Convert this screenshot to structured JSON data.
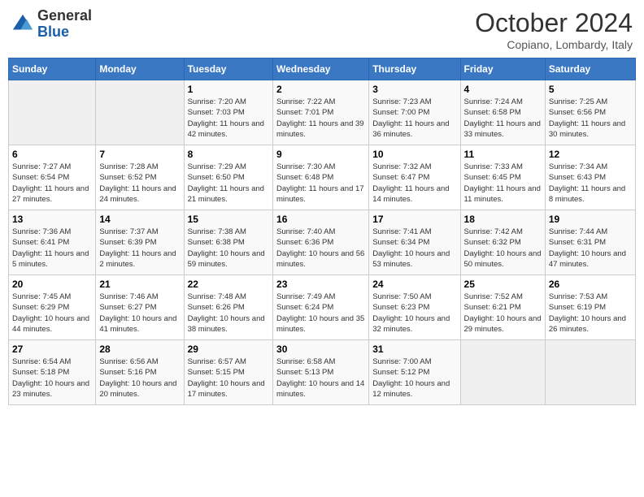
{
  "logo": {
    "general": "General",
    "blue": "Blue"
  },
  "header": {
    "month": "October 2024",
    "location": "Copiano, Lombardy, Italy"
  },
  "weekdays": [
    "Sunday",
    "Monday",
    "Tuesday",
    "Wednesday",
    "Thursday",
    "Friday",
    "Saturday"
  ],
  "weeks": [
    [
      {
        "day": "",
        "info": ""
      },
      {
        "day": "",
        "info": ""
      },
      {
        "day": "1",
        "info": "Sunrise: 7:20 AM\nSunset: 7:03 PM\nDaylight: 11 hours and 42 minutes."
      },
      {
        "day": "2",
        "info": "Sunrise: 7:22 AM\nSunset: 7:01 PM\nDaylight: 11 hours and 39 minutes."
      },
      {
        "day": "3",
        "info": "Sunrise: 7:23 AM\nSunset: 7:00 PM\nDaylight: 11 hours and 36 minutes."
      },
      {
        "day": "4",
        "info": "Sunrise: 7:24 AM\nSunset: 6:58 PM\nDaylight: 11 hours and 33 minutes."
      },
      {
        "day": "5",
        "info": "Sunrise: 7:25 AM\nSunset: 6:56 PM\nDaylight: 11 hours and 30 minutes."
      }
    ],
    [
      {
        "day": "6",
        "info": "Sunrise: 7:27 AM\nSunset: 6:54 PM\nDaylight: 11 hours and 27 minutes."
      },
      {
        "day": "7",
        "info": "Sunrise: 7:28 AM\nSunset: 6:52 PM\nDaylight: 11 hours and 24 minutes."
      },
      {
        "day": "8",
        "info": "Sunrise: 7:29 AM\nSunset: 6:50 PM\nDaylight: 11 hours and 21 minutes."
      },
      {
        "day": "9",
        "info": "Sunrise: 7:30 AM\nSunset: 6:48 PM\nDaylight: 11 hours and 17 minutes."
      },
      {
        "day": "10",
        "info": "Sunrise: 7:32 AM\nSunset: 6:47 PM\nDaylight: 11 hours and 14 minutes."
      },
      {
        "day": "11",
        "info": "Sunrise: 7:33 AM\nSunset: 6:45 PM\nDaylight: 11 hours and 11 minutes."
      },
      {
        "day": "12",
        "info": "Sunrise: 7:34 AM\nSunset: 6:43 PM\nDaylight: 11 hours and 8 minutes."
      }
    ],
    [
      {
        "day": "13",
        "info": "Sunrise: 7:36 AM\nSunset: 6:41 PM\nDaylight: 11 hours and 5 minutes."
      },
      {
        "day": "14",
        "info": "Sunrise: 7:37 AM\nSunset: 6:39 PM\nDaylight: 11 hours and 2 minutes."
      },
      {
        "day": "15",
        "info": "Sunrise: 7:38 AM\nSunset: 6:38 PM\nDaylight: 10 hours and 59 minutes."
      },
      {
        "day": "16",
        "info": "Sunrise: 7:40 AM\nSunset: 6:36 PM\nDaylight: 10 hours and 56 minutes."
      },
      {
        "day": "17",
        "info": "Sunrise: 7:41 AM\nSunset: 6:34 PM\nDaylight: 10 hours and 53 minutes."
      },
      {
        "day": "18",
        "info": "Sunrise: 7:42 AM\nSunset: 6:32 PM\nDaylight: 10 hours and 50 minutes."
      },
      {
        "day": "19",
        "info": "Sunrise: 7:44 AM\nSunset: 6:31 PM\nDaylight: 10 hours and 47 minutes."
      }
    ],
    [
      {
        "day": "20",
        "info": "Sunrise: 7:45 AM\nSunset: 6:29 PM\nDaylight: 10 hours and 44 minutes."
      },
      {
        "day": "21",
        "info": "Sunrise: 7:46 AM\nSunset: 6:27 PM\nDaylight: 10 hours and 41 minutes."
      },
      {
        "day": "22",
        "info": "Sunrise: 7:48 AM\nSunset: 6:26 PM\nDaylight: 10 hours and 38 minutes."
      },
      {
        "day": "23",
        "info": "Sunrise: 7:49 AM\nSunset: 6:24 PM\nDaylight: 10 hours and 35 minutes."
      },
      {
        "day": "24",
        "info": "Sunrise: 7:50 AM\nSunset: 6:23 PM\nDaylight: 10 hours and 32 minutes."
      },
      {
        "day": "25",
        "info": "Sunrise: 7:52 AM\nSunset: 6:21 PM\nDaylight: 10 hours and 29 minutes."
      },
      {
        "day": "26",
        "info": "Sunrise: 7:53 AM\nSunset: 6:19 PM\nDaylight: 10 hours and 26 minutes."
      }
    ],
    [
      {
        "day": "27",
        "info": "Sunrise: 6:54 AM\nSunset: 5:18 PM\nDaylight: 10 hours and 23 minutes."
      },
      {
        "day": "28",
        "info": "Sunrise: 6:56 AM\nSunset: 5:16 PM\nDaylight: 10 hours and 20 minutes."
      },
      {
        "day": "29",
        "info": "Sunrise: 6:57 AM\nSunset: 5:15 PM\nDaylight: 10 hours and 17 minutes."
      },
      {
        "day": "30",
        "info": "Sunrise: 6:58 AM\nSunset: 5:13 PM\nDaylight: 10 hours and 14 minutes."
      },
      {
        "day": "31",
        "info": "Sunrise: 7:00 AM\nSunset: 5:12 PM\nDaylight: 10 hours and 12 minutes."
      },
      {
        "day": "",
        "info": ""
      },
      {
        "day": "",
        "info": ""
      }
    ]
  ]
}
